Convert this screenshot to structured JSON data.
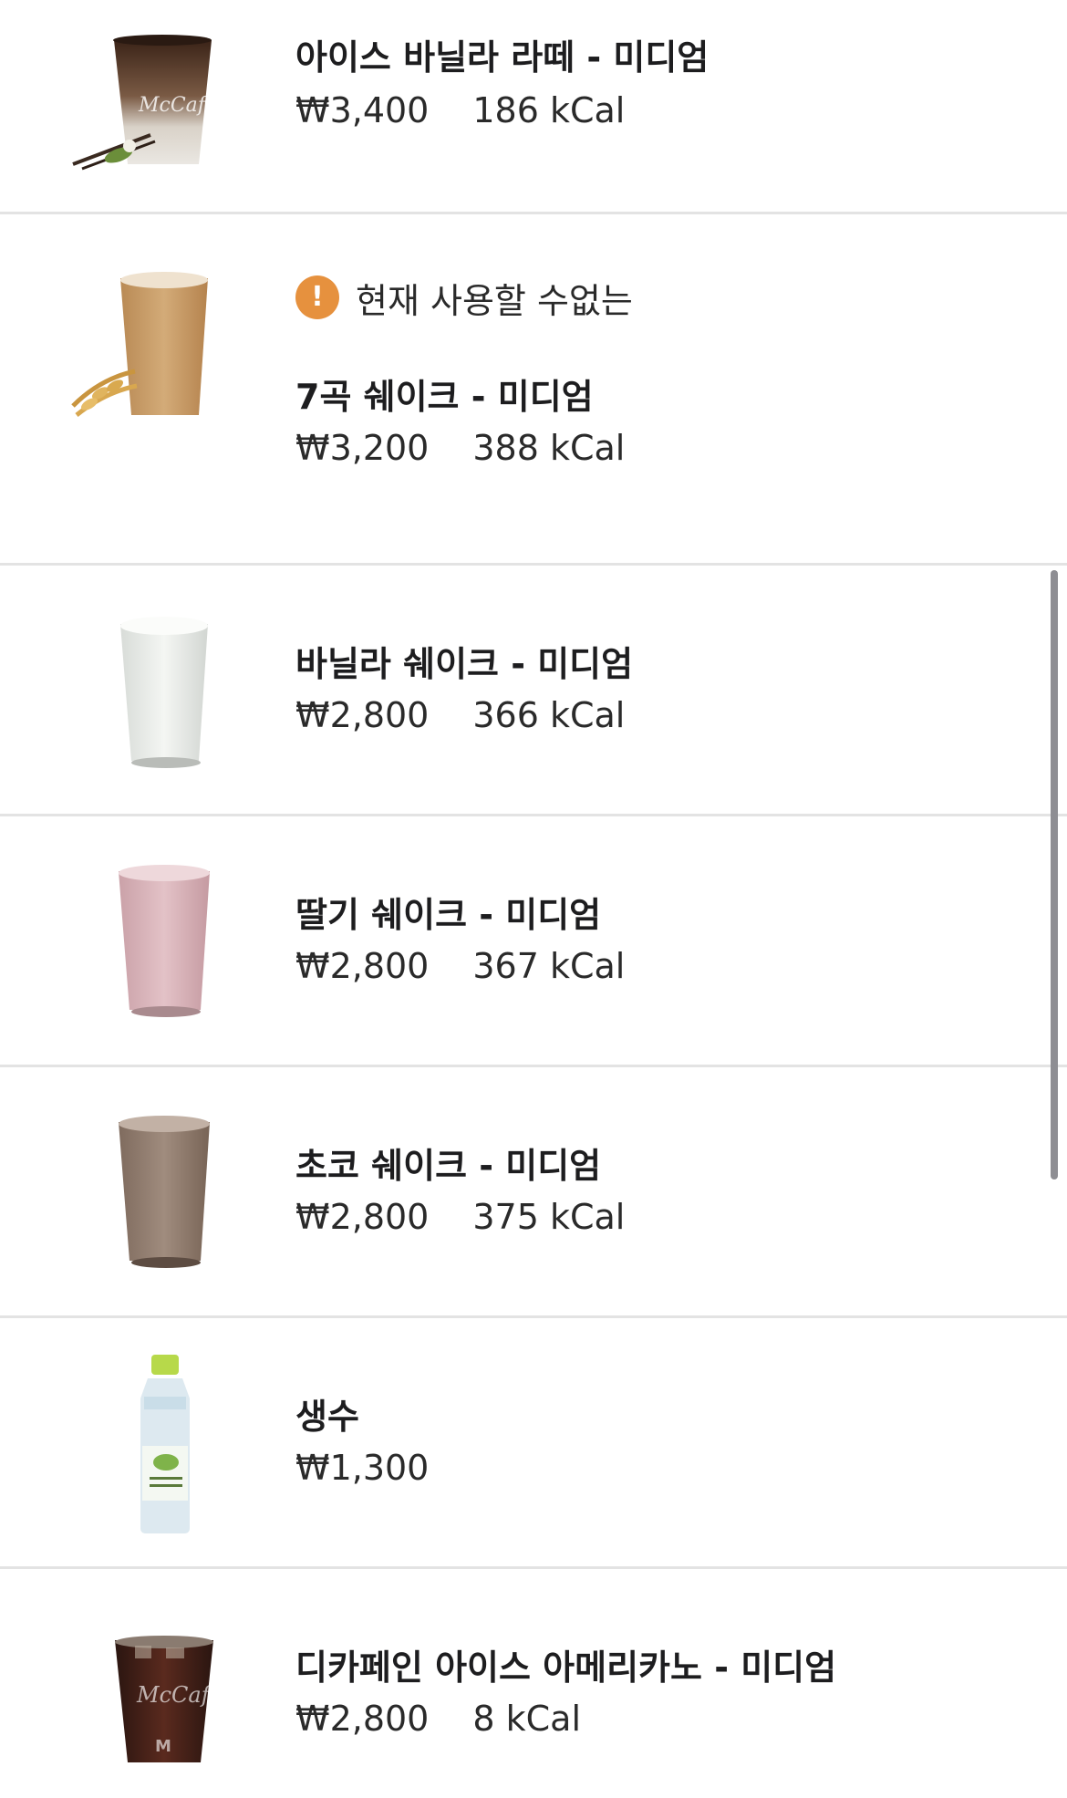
{
  "menu": {
    "items": [
      {
        "name": "아이스 바닐라 라떼 - 미디엄",
        "price": "₩3,400",
        "kcal": "186 kCal",
        "icon": "iced-vanilla-latte-image"
      },
      {
        "name": "7곡 쉐이크 - 미디엄",
        "price": "₩3,200",
        "kcal": "388 kCal",
        "status": "현재 사용할 수없는",
        "icon": "grain-shake-image"
      },
      {
        "name": "바닐라 쉐이크 - 미디엄",
        "price": "₩2,800",
        "kcal": "366 kCal",
        "icon": "vanilla-shake-image"
      },
      {
        "name": "딸기 쉐이크 - 미디엄",
        "price": "₩2,800",
        "kcal": "367 kCal",
        "icon": "strawberry-shake-image"
      },
      {
        "name": "초코 쉐이크 - 미디엄",
        "price": "₩2,800",
        "kcal": "375 kCal",
        "icon": "chocolate-shake-image"
      },
      {
        "name": "생수",
        "price": "₩1,300",
        "icon": "water-bottle-image"
      },
      {
        "name": "디카페인 아이스 아메리카노 - 미디엄",
        "price": "₩2,800",
        "kcal": "8 kCal",
        "icon": "decaf-iced-americano-image"
      }
    ]
  },
  "colors": {
    "warning": "#e6913e",
    "divider": "#e3e3e3",
    "scrollbar": "#8e8e93"
  }
}
